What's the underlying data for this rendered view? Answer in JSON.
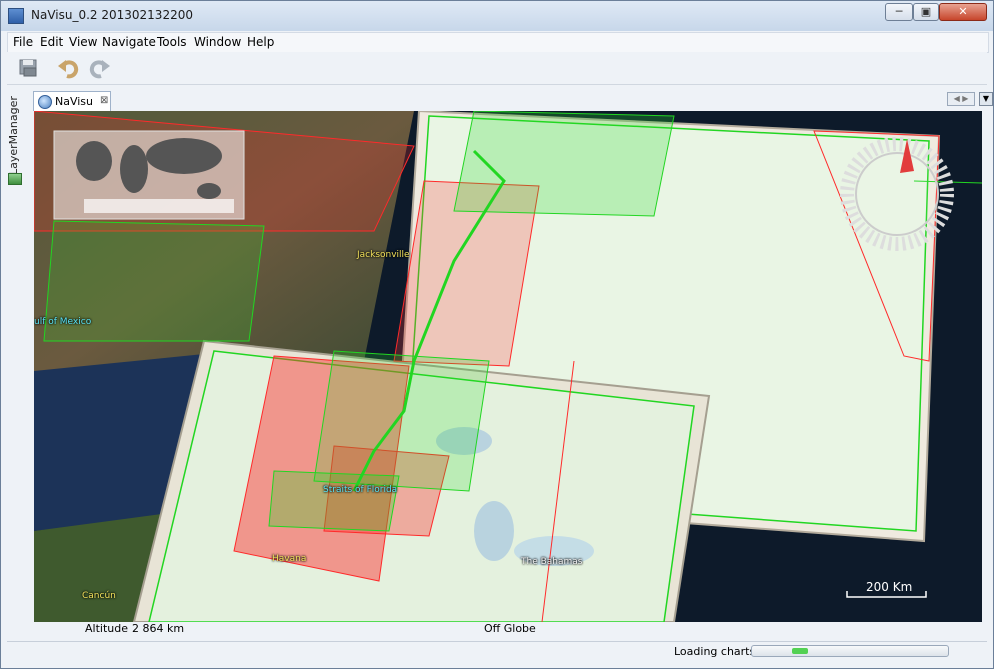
{
  "window": {
    "title": "NaVisu_0.2 201302132200",
    "minimize": "─",
    "restore": "▣",
    "close": "✕"
  },
  "menu": [
    "File",
    "Edit",
    "View",
    "Navigate",
    "Tools",
    "Window",
    "Help"
  ],
  "side_panel": {
    "label": "LayerManager"
  },
  "tabs": [
    {
      "label": "NaVisu",
      "close": "⊠"
    }
  ],
  "tab_nav": {
    "arrows": "◀ ▶",
    "dropdown": "▼",
    "maximize": "▭"
  },
  "map": {
    "labels": {
      "jacksonville": "Jacksonville",
      "gulf": "ulf of Mexico",
      "straits": "Straits of Florida",
      "havana": "Havana",
      "bahamas": "The Bahamas",
      "cancun": "Cancún"
    },
    "scale": "200 Km"
  },
  "status": {
    "altitude_label": "Altitude",
    "altitude_value": "2 864 km",
    "position": "Off Globe"
  },
  "loading": {
    "label": "Loading charts",
    "progress": 0.08
  },
  "colors": {
    "frame_red": "#ff2a2a",
    "frame_green": "#22d622",
    "ocean": "#0b1420"
  }
}
